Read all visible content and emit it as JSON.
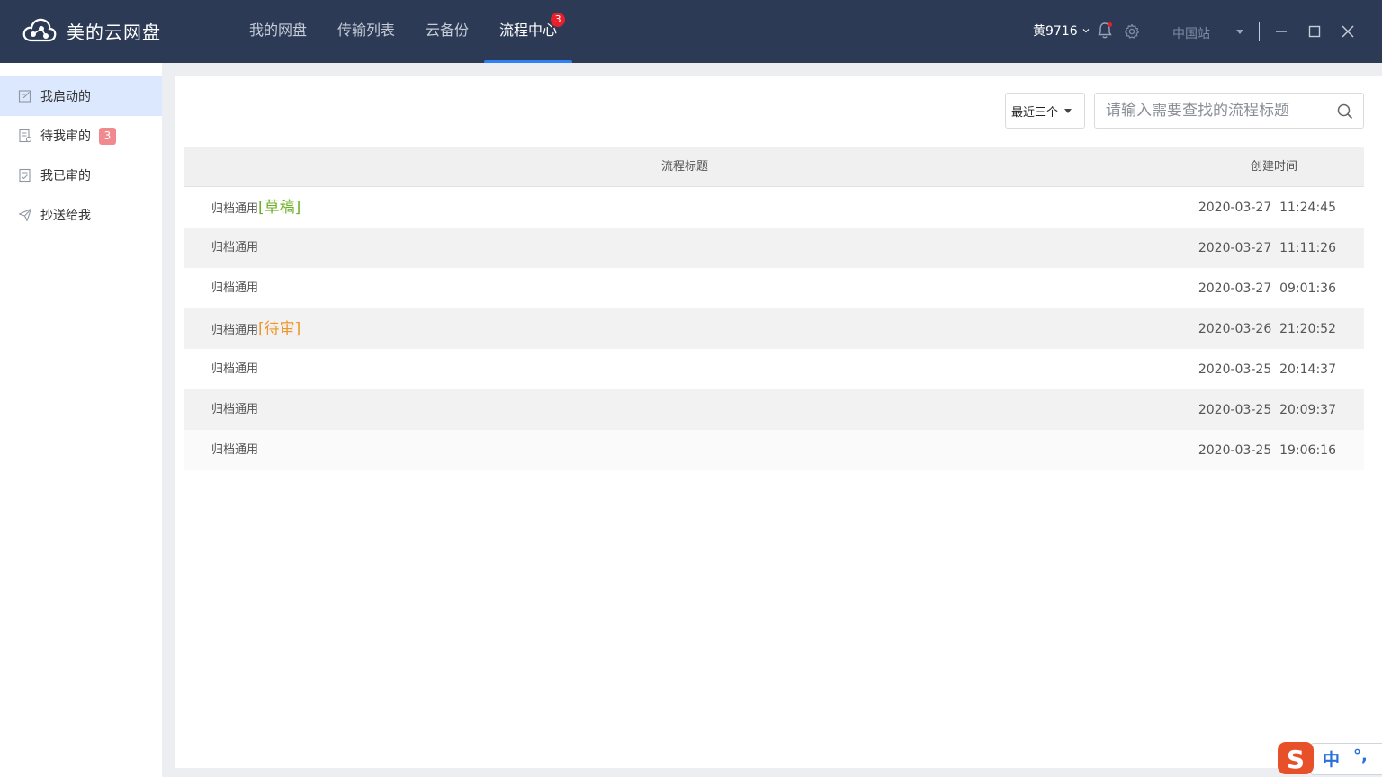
{
  "app": {
    "name": "美的云网盘"
  },
  "nav": {
    "tabs": [
      {
        "label": "我的网盘",
        "active": false
      },
      {
        "label": "传输列表",
        "active": false
      },
      {
        "label": "云备份",
        "active": false
      },
      {
        "label": "流程中心",
        "active": true,
        "badge": "3"
      }
    ]
  },
  "header": {
    "user": "黄9716",
    "site": "中国站",
    "icons": [
      "bell-icon",
      "gear-icon",
      "minimize-icon",
      "maximize-icon",
      "close-icon"
    ]
  },
  "sidebar": {
    "items": [
      {
        "label": "我启动的",
        "icon": "edit-doc-icon",
        "active": true
      },
      {
        "label": "待我审的",
        "icon": "pending-doc-icon",
        "badge": "3"
      },
      {
        "label": "我已审的",
        "icon": "approved-doc-icon"
      },
      {
        "label": "抄送给我",
        "icon": "send-icon"
      }
    ]
  },
  "toolbar": {
    "filter_value": "最近三个",
    "search_placeholder": "请输入需要查找的流程标题"
  },
  "table": {
    "columns": [
      "流程标题",
      "创建时间"
    ],
    "rows": [
      {
        "title": "归档通用",
        "tag": "[草稿]",
        "time": "2020-03-27  11:24:45"
      },
      {
        "title": "归档通用",
        "tag": "",
        "time": "2020-03-27  11:11:26"
      },
      {
        "title": "归档通用",
        "tag": "",
        "time": "2020-03-27  09:01:36"
      },
      {
        "title": "归档通用",
        "tag": "[待审]",
        "time": "2020-03-26  21:20:52"
      },
      {
        "title": "归档通用",
        "tag": "",
        "time": "2020-03-25  20:14:37"
      },
      {
        "title": "归档通用",
        "tag": "",
        "time": "2020-03-25  20:09:37"
      },
      {
        "title": "归档通用",
        "tag": "",
        "time": "2020-03-25  19:06:16"
      }
    ]
  },
  "ime": {
    "lang": "中",
    "punct": "°,"
  },
  "colors": {
    "header_bg": "#2c3a55",
    "accent": "#2f7ff5",
    "badge": "#e8202a",
    "draft": "#6ab022",
    "pending": "#f09528",
    "sidebar_active": "#dbe8fd"
  }
}
